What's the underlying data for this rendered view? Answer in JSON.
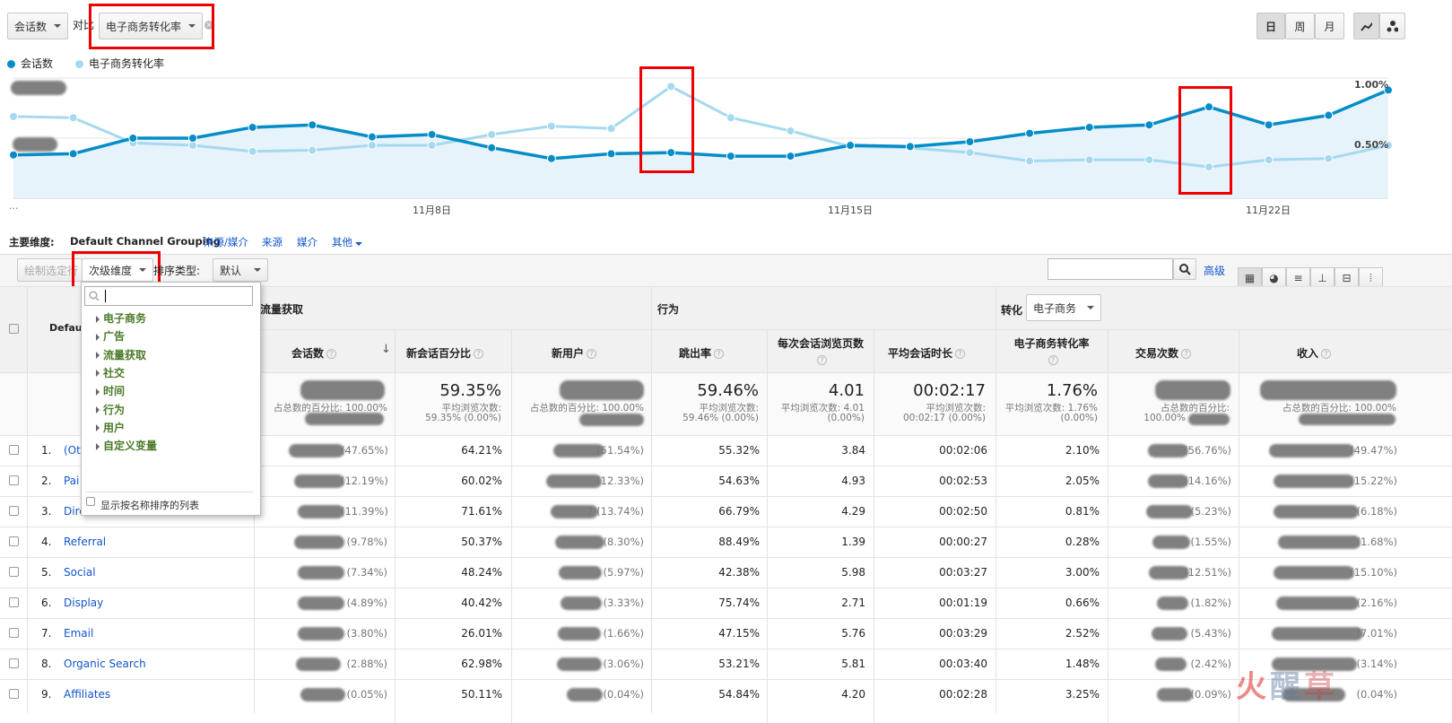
{
  "controls": {
    "metric_select": "会话数",
    "compare_label": "对比",
    "compare_select": "电子商务转化率",
    "granularity": [
      "日",
      "周",
      "月"
    ]
  },
  "legend": [
    {
      "name": "会话数",
      "color": "#058dc7"
    },
    {
      "name": "电子商务转化率",
      "color": "#a5d9ef"
    }
  ],
  "chart_data": {
    "type": "line",
    "x_tick_labels": [
      "11月8日",
      "11月15日",
      "11月22日"
    ],
    "right_axis_labels": [
      "1.00%",
      "0.50%"
    ],
    "left_axis_more": "...",
    "series": [
      {
        "name": "会话数",
        "color": "#058dc7",
        "values": [
          0.36,
          0.37,
          0.5,
          0.5,
          0.59,
          0.61,
          0.51,
          0.53,
          0.42,
          0.33,
          0.37,
          0.38,
          0.35,
          0.35,
          0.44,
          0.43,
          0.47,
          0.54,
          0.59,
          0.61,
          0.76,
          0.61,
          0.69,
          0.9
        ]
      },
      {
        "name": "电子商务转化率",
        "color": "#a5d9ef",
        "values": [
          0.68,
          0.67,
          0.46,
          0.44,
          0.39,
          0.4,
          0.44,
          0.44,
          0.53,
          0.6,
          0.58,
          0.93,
          0.67,
          0.56,
          0.43,
          0.42,
          0.38,
          0.31,
          0.32,
          0.32,
          0.26,
          0.32,
          0.33,
          0.44
        ]
      }
    ]
  },
  "dimension_bar": {
    "label": "主要维度:",
    "active": "Default Channel Grouping",
    "links": [
      "来源/媒介",
      "来源",
      "媒介"
    ],
    "other": "其他"
  },
  "toolbar": {
    "plot_rows": "绘制选定行",
    "secondary_dimension": "次级维度",
    "sort_type_label": "排序类型:",
    "sort_select": "默认",
    "advanced": "高级"
  },
  "dropdown": {
    "items": [
      "电子商务",
      "广告",
      "流量获取",
      "社交",
      "时间",
      "行为",
      "用户",
      "自定义变量"
    ],
    "footer": "显示按名称排序的列表"
  },
  "table": {
    "group_headers": {
      "acquisition": "流量获取",
      "behavior": "行为",
      "conversion": "转化",
      "conversion_select": "电子商务"
    },
    "dim_header": "Defaul",
    "columns": [
      "会话数",
      "新会话百分比",
      "新用户",
      "跳出率",
      "每次会话浏览页数",
      "平均会话时长",
      "电子商务转化率",
      "交易次数",
      "收入"
    ],
    "totals": {
      "sessions_sub": "占总数的百分比: 100.00%",
      "new_pct": "59.35%",
      "new_pct_sub1": "平均浏览次数:",
      "new_pct_sub2": "59.35% (0.00%)",
      "new_users_sub": "占总数的百分比: 100.00%",
      "bounce": "59.46%",
      "bounce_sub1": "平均浏览次数:",
      "bounce_sub2": "59.46% (0.00%)",
      "pages": "4.01",
      "pages_sub1": "平均浏览次数: 4.01",
      "pages_sub2": "(0.00%)",
      "duration": "00:02:17",
      "duration_sub1": "平均浏览次数:",
      "duration_sub2": "00:02:17 (0.00%)",
      "conv": "1.76%",
      "conv_sub1": "平均浏览次数: 1.76%",
      "conv_sub2": "(0.00%)",
      "trans_sub1": "占总数的百分比:",
      "trans_sub2": "100.00%",
      "revenue_sub": "占总数的百分比: 100.00%"
    },
    "rows": [
      {
        "idx": "1.",
        "name": "(Ot",
        "sessions_pct": "(47.65%)",
        "new_pct": "64.21%",
        "new_users_pct": "(51.54%)",
        "bounce": "55.32%",
        "pages": "3.84",
        "duration": "00:02:06",
        "conv": "2.10%",
        "trans_pct": "(56.76%)",
        "rev_pct": "(49.47%)"
      },
      {
        "idx": "2.",
        "name": "Pai",
        "sessions_pct": "(12.19%)",
        "new_pct": "60.02%",
        "new_users_pct": "(12.33%)",
        "bounce": "54.63%",
        "pages": "4.93",
        "duration": "00:02:53",
        "conv": "2.05%",
        "trans_pct": "(14.16%)",
        "rev_pct": "(15.22%)"
      },
      {
        "idx": "3.",
        "name": "Dire",
        "sessions_pct": "(11.39%)",
        "new_pct": "71.61%",
        "new_users_pct": "7 (13.74%)",
        "bounce": "66.79%",
        "pages": "4.29",
        "duration": "00:02:50",
        "conv": "0.81%",
        "trans_pct": "(5.23%)",
        "rev_pct": "(6.18%)"
      },
      {
        "idx": "4.",
        "name": "Referral",
        "sessions_pct": "(9.78%)",
        "new_pct": "50.37%",
        "new_users_pct": "(8.30%)",
        "bounce": "88.49%",
        "pages": "1.39",
        "duration": "00:00:27",
        "conv": "0.28%",
        "trans_pct": "(1.55%)",
        "rev_pct": "(1.68%)"
      },
      {
        "idx": "5.",
        "name": "Social",
        "sessions_pct": "(7.34%)",
        "new_pct": "48.24%",
        "new_users_pct": "(5.97%)",
        "bounce": "42.38%",
        "pages": "5.98",
        "duration": "00:03:27",
        "conv": "3.00%",
        "trans_pct": "(12.51%)",
        "rev_pct": "(15.10%)"
      },
      {
        "idx": "6.",
        "name": "Display",
        "sessions_pct": "(4.89%)",
        "new_pct": "40.42%",
        "new_users_pct": "(3.33%)",
        "bounce": "75.74%",
        "pages": "2.71",
        "duration": "00:01:19",
        "conv": "0.66%",
        "trans_pct": "(1.82%)",
        "rev_pct": "(2.16%)"
      },
      {
        "idx": "7.",
        "name": "Email",
        "sessions_pct": "(3.80%)",
        "new_pct": "26.01%",
        "new_users_pct": "(1.66%)",
        "bounce": "47.15%",
        "pages": "5.76",
        "duration": "00:03:29",
        "conv": "2.52%",
        "trans_pct": "(5.43%)",
        "rev_pct": "(7.01%)"
      },
      {
        "idx": "8.",
        "name": "Organic Search",
        "sessions_pct": "(2.88%)",
        "new_pct": "62.98%",
        "new_users_pct": "(3.06%)",
        "bounce": "53.21%",
        "pages": "5.81",
        "duration": "00:03:40",
        "conv": "1.48%",
        "trans_pct": "(2.42%)",
        "rev_pct": "(3.14%)"
      },
      {
        "idx": "9.",
        "name": "Affiliates",
        "sessions_pct": "(0.05%)",
        "new_pct": "50.11%",
        "new_users_pct": "(0.04%)",
        "bounce": "54.84%",
        "pages": "4.20",
        "duration": "00:02:28",
        "conv": "3.25%",
        "trans_pct": "(0.09%)",
        "rev_pct": "(0.04%)"
      }
    ]
  }
}
